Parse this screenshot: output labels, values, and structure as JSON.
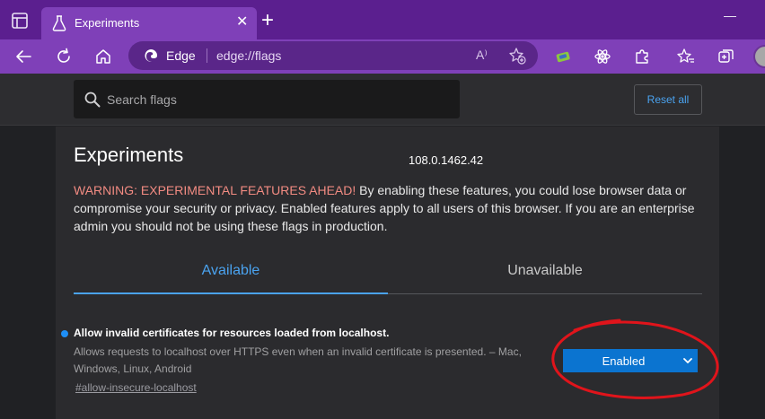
{
  "browser": {
    "tab": {
      "title": "Experiments"
    },
    "new_tab_label": "+",
    "close_label": "✕",
    "address": {
      "site_name": "Edge",
      "url": "edge://flags",
      "read_aloud": "A⁾"
    },
    "colors": {
      "tabbar": "#5b1f8f",
      "toolbar": "#7f40b8",
      "accent": "#4aa3f0"
    }
  },
  "flags_header": {
    "search_placeholder": "Search flags",
    "reset_label": "Reset all"
  },
  "main": {
    "title": "Experiments",
    "version": "108.0.1462.42",
    "warning_strong": "WARNING: EXPERIMENTAL FEATURES AHEAD!",
    "warning_body": " By enabling these features, you could lose browser data or compromise your security or privacy. Enabled features apply to all users of this browser. If you are an enterprise admin you should not be using these flags in production.",
    "tabs": [
      {
        "label": "Available",
        "active": true
      },
      {
        "label": "Unavailable",
        "active": false
      }
    ]
  },
  "flag": {
    "name": "Allow invalid certificates for resources loaded from localhost.",
    "description": "Allows requests to localhost over HTTPS even when an invalid certificate is presented. – Mac, Windows, Linux, Android",
    "anchor": "#allow-insecure-localhost",
    "selected_value": "Enabled",
    "modified": true,
    "select_color": "#0b74d0"
  },
  "annotation": {
    "color": "#e0141b",
    "shape": "hand-drawn ellipse around the Enabled dropdown"
  }
}
